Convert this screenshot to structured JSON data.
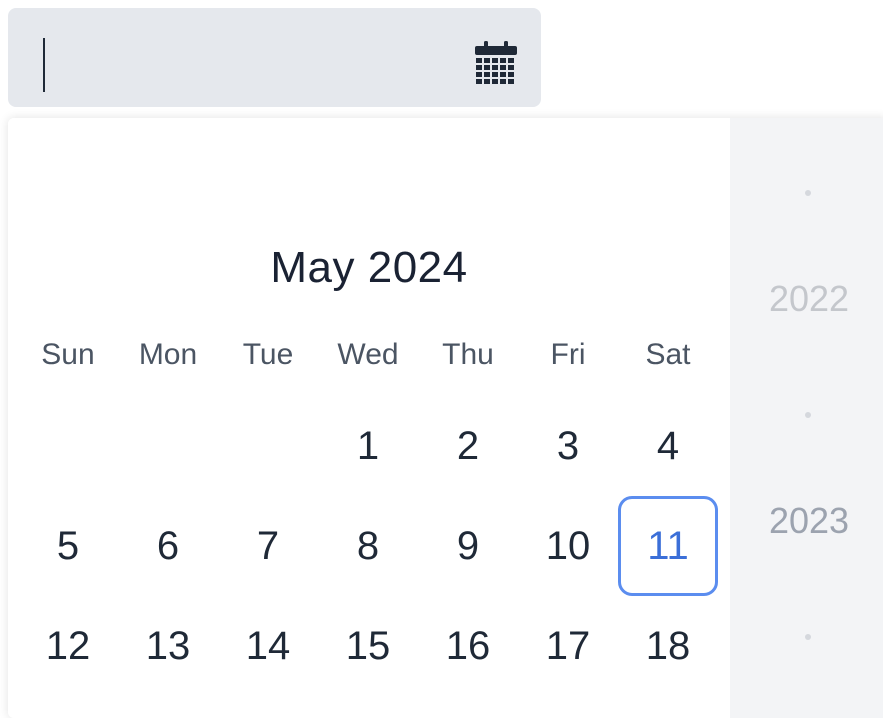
{
  "date_input": {
    "value": "",
    "placeholder": ""
  },
  "calendar": {
    "month_title": "May 2024",
    "weekdays": [
      "Sun",
      "Mon",
      "Tue",
      "Wed",
      "Thu",
      "Fri",
      "Sat"
    ],
    "weeks": [
      [
        "",
        "",
        "",
        "1",
        "2",
        "3",
        "4"
      ],
      [
        "5",
        "6",
        "7",
        "8",
        "9",
        "10",
        "11"
      ],
      [
        "12",
        "13",
        "14",
        "15",
        "16",
        "17",
        "18"
      ]
    ],
    "focused_day": "11"
  },
  "year_picker": {
    "years": [
      "2022",
      "2023"
    ]
  },
  "icons": {
    "calendar": "calendar-icon"
  },
  "colors": {
    "focus_ring": "#5b8def",
    "focused_text": "#3b6fd8",
    "input_bg": "#e5e8ed"
  }
}
